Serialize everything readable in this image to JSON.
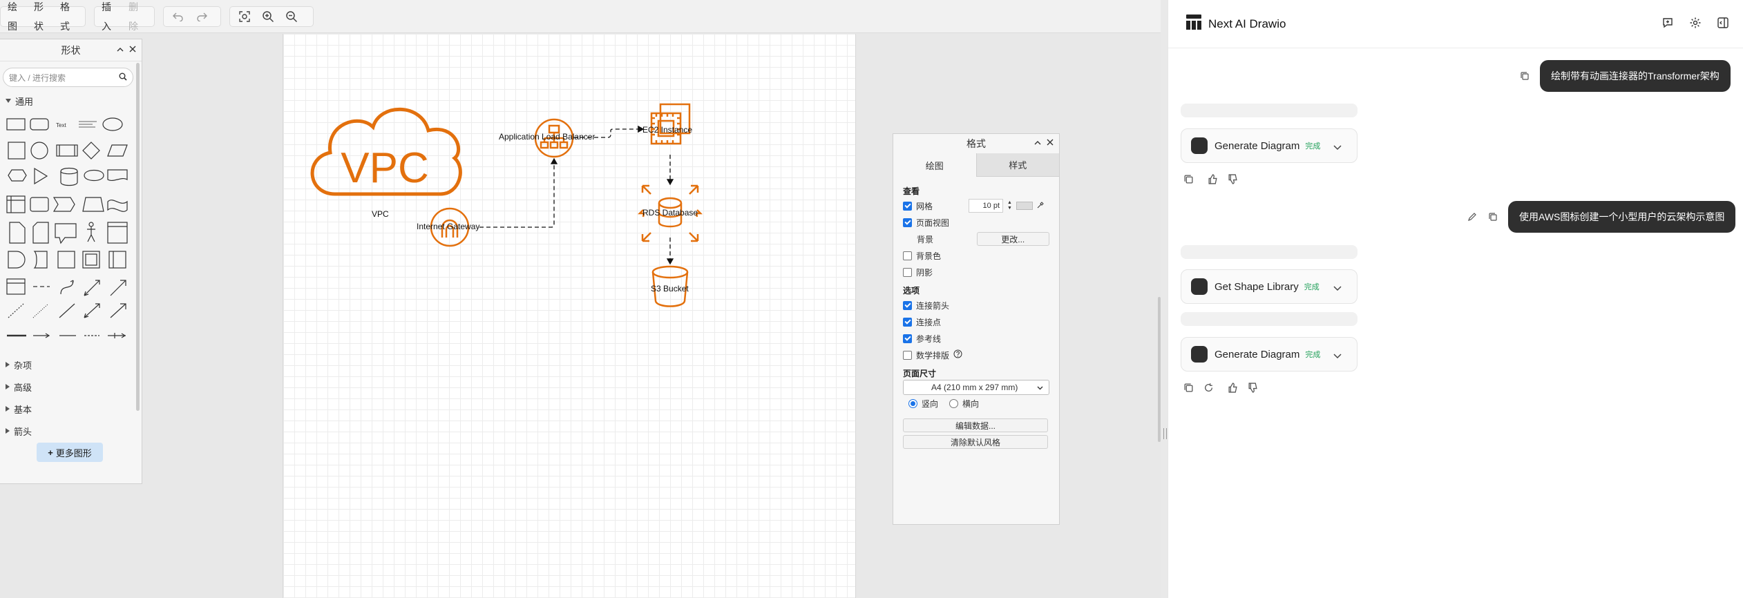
{
  "toolbar": {
    "menu": [
      "绘图",
      "形状",
      "格式"
    ],
    "insert": "插入",
    "delete": "删除"
  },
  "shapes_panel": {
    "title": "形状",
    "search_placeholder": "键入 / 进行搜索",
    "general": "通用",
    "sections": [
      "杂项",
      "高级",
      "基本",
      "箭头"
    ],
    "more_shapes": "更多图形"
  },
  "diagram": {
    "vpc_text": "VPC",
    "vpc_label": "VPC",
    "alb_label": "Application Load Balancer",
    "ec2_label": "EC2 Instance",
    "igw_label": "Internet Gateway",
    "rds_label": "RDS Database",
    "s3_label": "S3 Bucket",
    "accent": "#e3700d"
  },
  "format_panel": {
    "title": "格式",
    "tabs": [
      "绘图",
      "样式"
    ],
    "view_section": "查看",
    "grid_label": "网格",
    "grid_size": "10 pt",
    "page_view": "页面视图",
    "background_label": "背景",
    "change_btn": "更改...",
    "bg_color": "背景色",
    "shadow": "阴影",
    "options_section": "选项",
    "connection_arrows": "连接箭头",
    "connection_points": "连接点",
    "guides": "参考线",
    "math": "数学排版",
    "page_size_section": "页面尺寸",
    "page_size_value": "A4 (210 mm x 297 mm)",
    "portrait": "竖向",
    "landscape": "横向",
    "edit_data": "编辑数据...",
    "clear_style": "清除默认风格"
  },
  "chat": {
    "app_title": "Next AI Drawio",
    "messages": [
      {
        "role": "user",
        "text": "绘制带有动画连接器的Transformer架构"
      },
      {
        "role": "user",
        "text": "使用AWS图标创建一个小型用户的云架构示意图"
      }
    ],
    "tools": [
      {
        "name": "Generate Diagram",
        "status": "完成"
      },
      {
        "name": "Get Shape Library",
        "status": "完成"
      },
      {
        "name": "Generate Diagram",
        "status": "完成"
      }
    ]
  }
}
